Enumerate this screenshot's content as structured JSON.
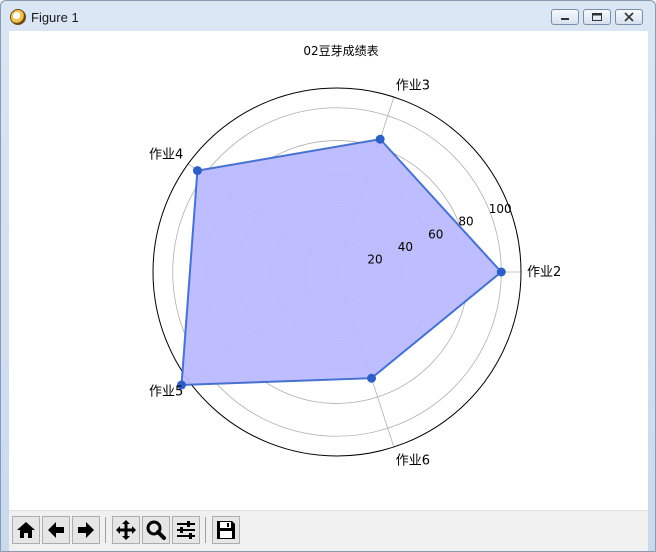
{
  "window": {
    "title": "Figure 1"
  },
  "toolbar": {
    "buttons": [
      {
        "name": "home-button",
        "icon": "home-icon"
      },
      {
        "name": "back-button",
        "icon": "arrow-left-icon"
      },
      {
        "name": "forward-button",
        "icon": "arrow-right-icon"
      },
      {
        "name": "pan-button",
        "icon": "move-icon"
      },
      {
        "name": "zoom-button",
        "icon": "magnifier-icon"
      },
      {
        "name": "configure-subplots-button",
        "icon": "sliders-icon"
      },
      {
        "name": "save-button",
        "icon": "floppy-disk-icon"
      }
    ]
  },
  "chart_data": {
    "type": "radar",
    "title": "02豆芽成绩表",
    "categories": [
      "作业2",
      "作业3",
      "作业4",
      "作业5",
      "作业6"
    ],
    "series": [
      {
        "values": [
          100,
          85,
          105,
          117,
          68
        ],
        "color": "#2d5fc7",
        "fill": "#b9b9ff"
      }
    ],
    "rlim": [
      0,
      112
    ],
    "rticks": [
      20,
      40,
      60,
      80,
      100
    ],
    "grid": true
  }
}
